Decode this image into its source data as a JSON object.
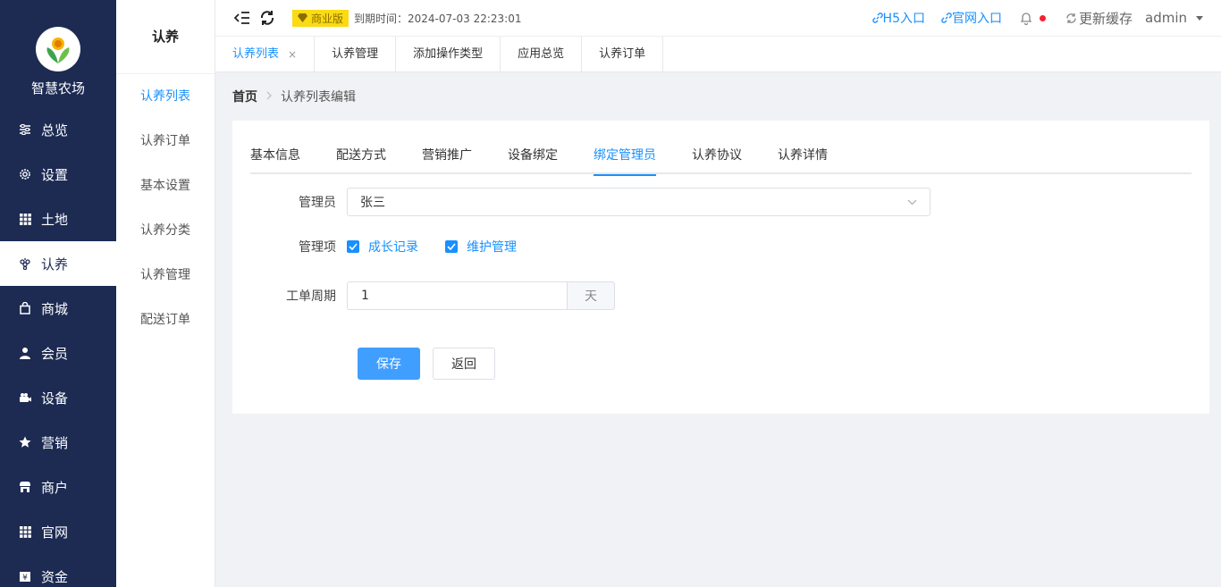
{
  "app": {
    "title": "智慧农场"
  },
  "sidebar": {
    "items": [
      {
        "label": "总览",
        "icon": "sliders-icon"
      },
      {
        "label": "设置",
        "icon": "gear-icon"
      },
      {
        "label": "土地",
        "icon": "grid-icon"
      },
      {
        "label": "认养",
        "icon": "grape-icon"
      },
      {
        "label": "商城",
        "icon": "bag-icon"
      },
      {
        "label": "会员",
        "icon": "user-icon"
      },
      {
        "label": "设备",
        "icon": "device-icon"
      },
      {
        "label": "营销",
        "icon": "star-icon"
      },
      {
        "label": "商户",
        "icon": "shop-icon"
      },
      {
        "label": "官网",
        "icon": "grid-icon"
      },
      {
        "label": "资金",
        "icon": "money-icon"
      }
    ],
    "active_index": 3
  },
  "subbar": {
    "title": "认养",
    "items": [
      "认养列表",
      "认养订单",
      "基本设置",
      "认养分类",
      "认养管理",
      "配送订单"
    ],
    "active_index": 0
  },
  "header": {
    "badge": "商业版",
    "expire": "到期时间：2024-07-03 22:23:01",
    "h5_link": "H5入口",
    "site_link": "官网入口",
    "refresh": "更新缓存",
    "user": "admin"
  },
  "tags": [
    {
      "label": "认养列表",
      "active": true,
      "closable": true
    },
    {
      "label": "认养管理"
    },
    {
      "label": "添加操作类型"
    },
    {
      "label": "应用总览"
    },
    {
      "label": "认养订单"
    }
  ],
  "breadcrumb": {
    "home": "首页",
    "current": "认养列表编辑"
  },
  "form_tabs": [
    "基本信息",
    "配送方式",
    "营销推广",
    "设备绑定",
    "绑定管理员",
    "认养协议",
    "认养详情"
  ],
  "form_tabs_active": 4,
  "form": {
    "admin_label": "管理员",
    "admin_value": "张三",
    "items_label": "管理项",
    "items": [
      "成长记录",
      "维护管理"
    ],
    "period_label": "工单周期",
    "period_value": "1",
    "period_unit": "天",
    "save": "保存",
    "back": "返回"
  },
  "colors": {
    "sidebar": "#1d2b53",
    "primary": "#1890ff",
    "badge": "#fadb14"
  }
}
